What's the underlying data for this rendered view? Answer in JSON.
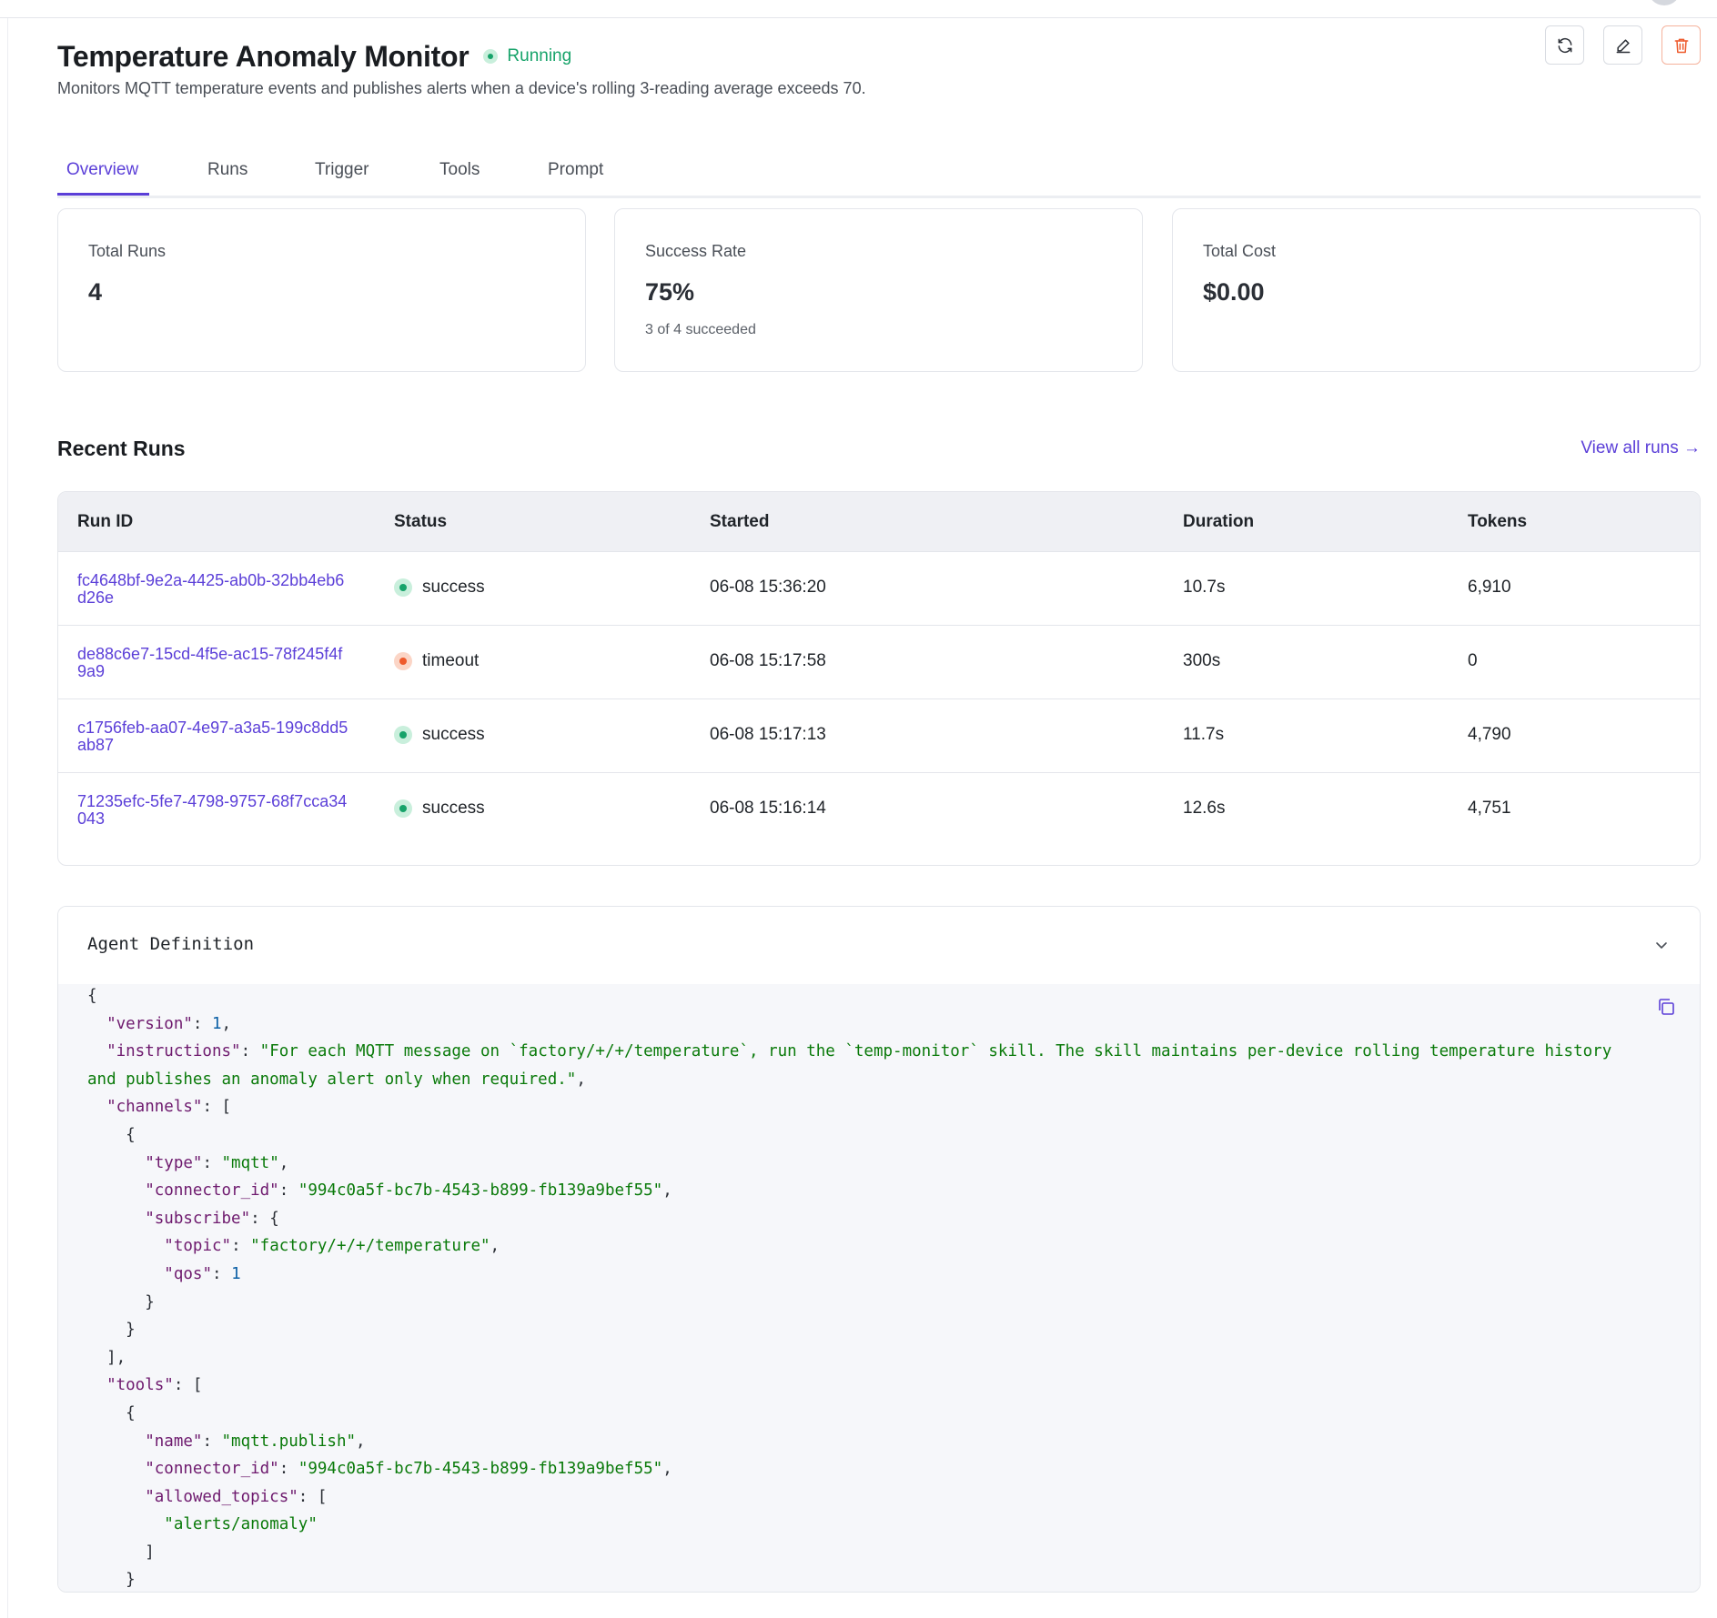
{
  "header": {
    "title": "Temperature Anomaly Monitor",
    "status": "Running",
    "description": "Monitors MQTT temperature events and publishes alerts when a device's rolling 3-reading average exceeds 70.",
    "actions": [
      {
        "name": "refresh",
        "icon": "refresh-icon"
      },
      {
        "name": "edit",
        "icon": "pencil-icon"
      },
      {
        "name": "delete",
        "icon": "trash-icon"
      }
    ]
  },
  "tabs": [
    {
      "label": "Overview",
      "active": true
    },
    {
      "label": "Runs",
      "active": false
    },
    {
      "label": "Trigger",
      "active": false
    },
    {
      "label": "Tools",
      "active": false
    },
    {
      "label": "Prompt",
      "active": false
    }
  ],
  "stats": [
    {
      "label": "Total Runs",
      "value": "4",
      "sub": ""
    },
    {
      "label": "Success Rate",
      "value": "75%",
      "sub": "3 of 4 succeeded"
    },
    {
      "label": "Total Cost",
      "value": "$0.00",
      "sub": ""
    }
  ],
  "recent_runs": {
    "title": "Recent Runs",
    "view_all": "View all runs →",
    "columns": [
      "Run ID",
      "Status",
      "Started",
      "Duration",
      "Tokens"
    ],
    "rows": [
      {
        "run_id": "fc4648bf-9e2a-4425-ab0b-32bb4eb6d26e",
        "status": "success",
        "started": "06-08 15:36:20",
        "duration": "10.7s",
        "tokens": "6,910"
      },
      {
        "run_id": "de88c6e7-15cd-4f5e-ac15-78f245f4f9a9",
        "status": "timeout",
        "started": "06-08 15:17:58",
        "duration": "300s",
        "tokens": "0"
      },
      {
        "run_id": "c1756feb-aa07-4e97-a3a5-199c8dd5ab87",
        "status": "success",
        "started": "06-08 15:17:13",
        "duration": "11.7s",
        "tokens": "4,790"
      },
      {
        "run_id": "71235efc-5fe7-4798-9757-68f7cca34043",
        "status": "success",
        "started": "06-08 15:16:14",
        "duration": "12.6s",
        "tokens": "4,751"
      }
    ]
  },
  "agent_definition": {
    "title": "Agent Definition",
    "lines": [
      [
        [
          "p",
          "{"
        ]
      ],
      [
        [
          "p",
          "  "
        ],
        [
          "k",
          "\"version\""
        ],
        [
          "p",
          ": "
        ],
        [
          "n",
          "1"
        ],
        [
          "p",
          ","
        ]
      ],
      [
        [
          "p",
          "  "
        ],
        [
          "k",
          "\"instructions\""
        ],
        [
          "p",
          ": "
        ],
        [
          "s",
          "\"For each MQTT message on `factory/+/+/temperature`, run the `temp-monitor` skill. The skill maintains per-device rolling temperature history and publishes an anomaly alert only when required.\""
        ],
        [
          "p",
          ","
        ]
      ],
      [
        [
          "p",
          "  "
        ],
        [
          "k",
          "\"channels\""
        ],
        [
          "p",
          ": ["
        ]
      ],
      [
        [
          "p",
          "    {"
        ]
      ],
      [
        [
          "p",
          "      "
        ],
        [
          "k",
          "\"type\""
        ],
        [
          "p",
          ": "
        ],
        [
          "s",
          "\"mqtt\""
        ],
        [
          "p",
          ","
        ]
      ],
      [
        [
          "p",
          "      "
        ],
        [
          "k",
          "\"connector_id\""
        ],
        [
          "p",
          ": "
        ],
        [
          "s",
          "\"994c0a5f-bc7b-4543-b899-fb139a9bef55\""
        ],
        [
          "p",
          ","
        ]
      ],
      [
        [
          "p",
          "      "
        ],
        [
          "k",
          "\"subscribe\""
        ],
        [
          "p",
          ": {"
        ]
      ],
      [
        [
          "p",
          "        "
        ],
        [
          "k",
          "\"topic\""
        ],
        [
          "p",
          ": "
        ],
        [
          "s",
          "\"factory/+/+/temperature\""
        ],
        [
          "p",
          ","
        ]
      ],
      [
        [
          "p",
          "        "
        ],
        [
          "k",
          "\"qos\""
        ],
        [
          "p",
          ": "
        ],
        [
          "n",
          "1"
        ]
      ],
      [
        [
          "p",
          "      }"
        ]
      ],
      [
        [
          "p",
          "    }"
        ]
      ],
      [
        [
          "p",
          "  ],"
        ]
      ],
      [
        [
          "p",
          "  "
        ],
        [
          "k",
          "\"tools\""
        ],
        [
          "p",
          ": ["
        ]
      ],
      [
        [
          "p",
          "    {"
        ]
      ],
      [
        [
          "p",
          "      "
        ],
        [
          "k",
          "\"name\""
        ],
        [
          "p",
          ": "
        ],
        [
          "s",
          "\"mqtt.publish\""
        ],
        [
          "p",
          ","
        ]
      ],
      [
        [
          "p",
          "      "
        ],
        [
          "k",
          "\"connector_id\""
        ],
        [
          "p",
          ": "
        ],
        [
          "s",
          "\"994c0a5f-bc7b-4543-b899-fb139a9bef55\""
        ],
        [
          "p",
          ","
        ]
      ],
      [
        [
          "p",
          "      "
        ],
        [
          "k",
          "\"allowed_topics\""
        ],
        [
          "p",
          ": ["
        ]
      ],
      [
        [
          "p",
          "        "
        ],
        [
          "s",
          "\"alerts/anomaly\""
        ]
      ],
      [
        [
          "p",
          "      ]"
        ]
      ],
      [
        [
          "p",
          "    }"
        ]
      ]
    ]
  },
  "colors": {
    "accent": "#5b3fd8",
    "success": "#17a36a",
    "timeout": "#ee5a2c",
    "json_key": "#6e1a6e",
    "json_string": "#0a7a0a",
    "json_number": "#0b5fa5"
  }
}
